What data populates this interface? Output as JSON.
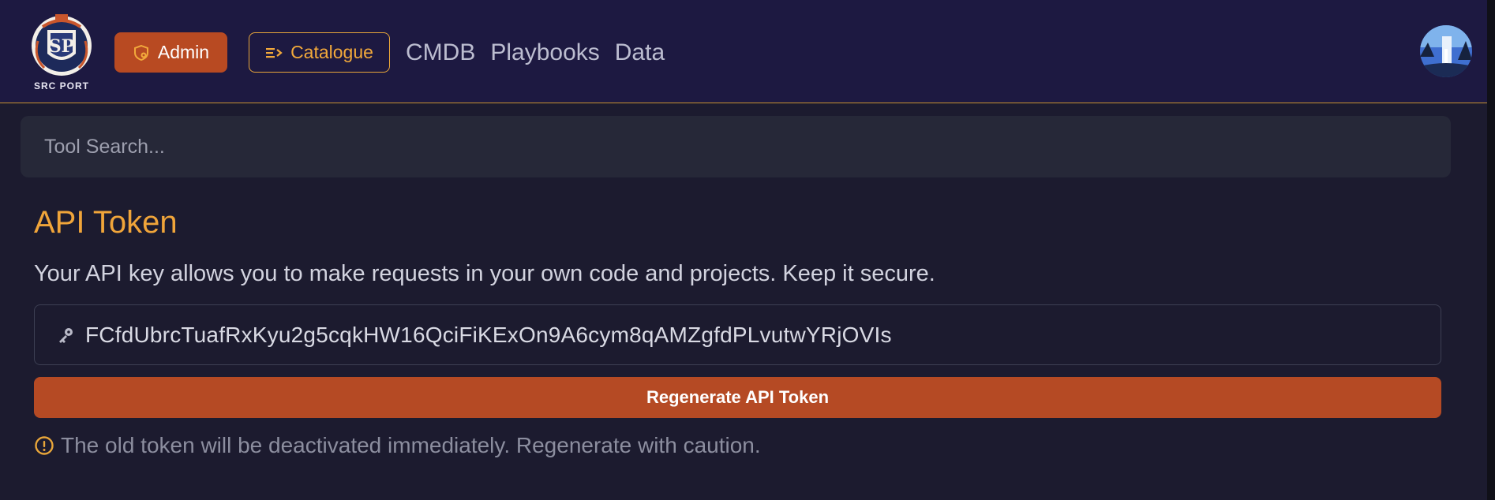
{
  "navbar": {
    "logo_text": "SRC PORT",
    "admin_label": "Admin",
    "catalogue_label": "Catalogue",
    "links": [
      "CMDB",
      "Playbooks",
      "Data"
    ]
  },
  "search": {
    "placeholder": "Tool Search..."
  },
  "api_token": {
    "title": "API Token",
    "description": "Your API key allows you to make requests in your own code and projects. Keep it secure.",
    "token_value": "FCfdUbrcTuafRxKyu2g5cqkHW16QciFiKExOn9A6cym8qAMZgfdPLvutwYRjOVIs",
    "regenerate_label": "Regenerate API Token",
    "warning": "The old token will be deactivated immediately. Regenerate with caution."
  },
  "colors": {
    "navbar_bg": "#1d1941",
    "page_bg": "#1c1b2f",
    "accent_orange": "#f0a53a",
    "button_rust": "#b54a24"
  },
  "icons": {
    "admin": "shield-gear-icon",
    "catalogue": "list-arrow-icon",
    "token": "key-icon",
    "warning": "alert-circle-icon"
  }
}
